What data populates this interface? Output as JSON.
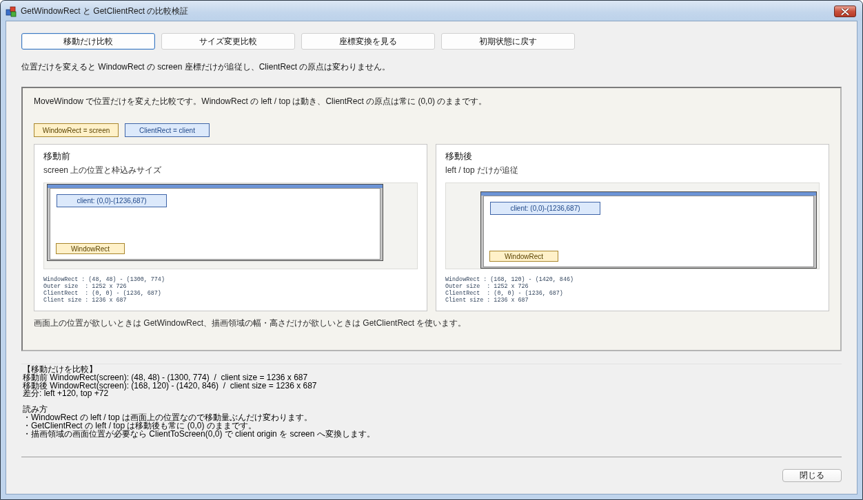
{
  "window": {
    "title": "GetWindowRect と GetClientRect の比較検証"
  },
  "toolbar_buttons": [
    {
      "label": "移動だけ比較",
      "focused": true
    },
    {
      "label": "サイズ変更比較",
      "focused": false
    },
    {
      "label": "座標変換を見る",
      "focused": false
    },
    {
      "label": "初期状態に戻す",
      "focused": false
    }
  ],
  "summary": "位置だけを変えると WindowRect の screen 座標だけが追従し、ClientRect の原点は変わりません。",
  "panel": {
    "intro": "MoveWindow で位置だけを変えた比較です。WindowRect の left / top は動き、ClientRect の原点は常に (0,0) のままです。",
    "legend": [
      {
        "label": "WindowRect = screen",
        "kind": "window"
      },
      {
        "label": "ClientRect = client",
        "kind": "client"
      }
    ],
    "cards": [
      {
        "kind": "before",
        "title": "移動前",
        "subtitle": "screen 上の位置と枠込みサイズ",
        "diagram": {
          "client_label": "client: (0,0)-(1236,687)",
          "window_label": "WindowRect"
        },
        "details": [
          "WindowRect : (48, 48) - (1300, 774)",
          "Outer size  : 1252 x 726",
          "ClientRect  : (0, 0) - (1236, 687)",
          "Client size : 1236 x 687"
        ]
      },
      {
        "kind": "after",
        "title": "移動後",
        "subtitle": "left / top だけが追従",
        "diagram": {
          "client_label": "client: (0,0)-(1236,687)",
          "window_label": "WindowRect"
        },
        "details": [
          "WindowRect : (168, 120) - (1420, 846)",
          "Outer size  : 1252 x 726",
          "ClientRect  : (0, 0) - (1236, 687)",
          "Client size : 1236 x 687"
        ]
      }
    ],
    "note": "画面上の位置が欲しいときは GetWindowRect、描画領域の幅・高さだけが欲しいときは GetClientRect を使います。"
  },
  "log": {
    "sections": [
      {
        "lines": [
          "【移動だけを比較】",
          "移動前 WindowRect(screen): (48, 48) - (1300, 774)  /  client size = 1236 x 687",
          "移動後 WindowRect(screen): (168, 120) - (1420, 846)  /  client size = 1236 x 687",
          "差分: left +120, top +72"
        ]
      },
      {
        "lines": [
          "読み方",
          "・WindowRect の left / top は画面上の位置なので移動量ぶんだけ変わります。",
          "・GetClientRect の left / top は移動後も常に (0,0) のままです。",
          "・描画領域の画面位置が必要なら ClientToScreen(0,0) で client origin を screen へ変換します。"
        ]
      }
    ]
  },
  "close_button": "閉じる"
}
